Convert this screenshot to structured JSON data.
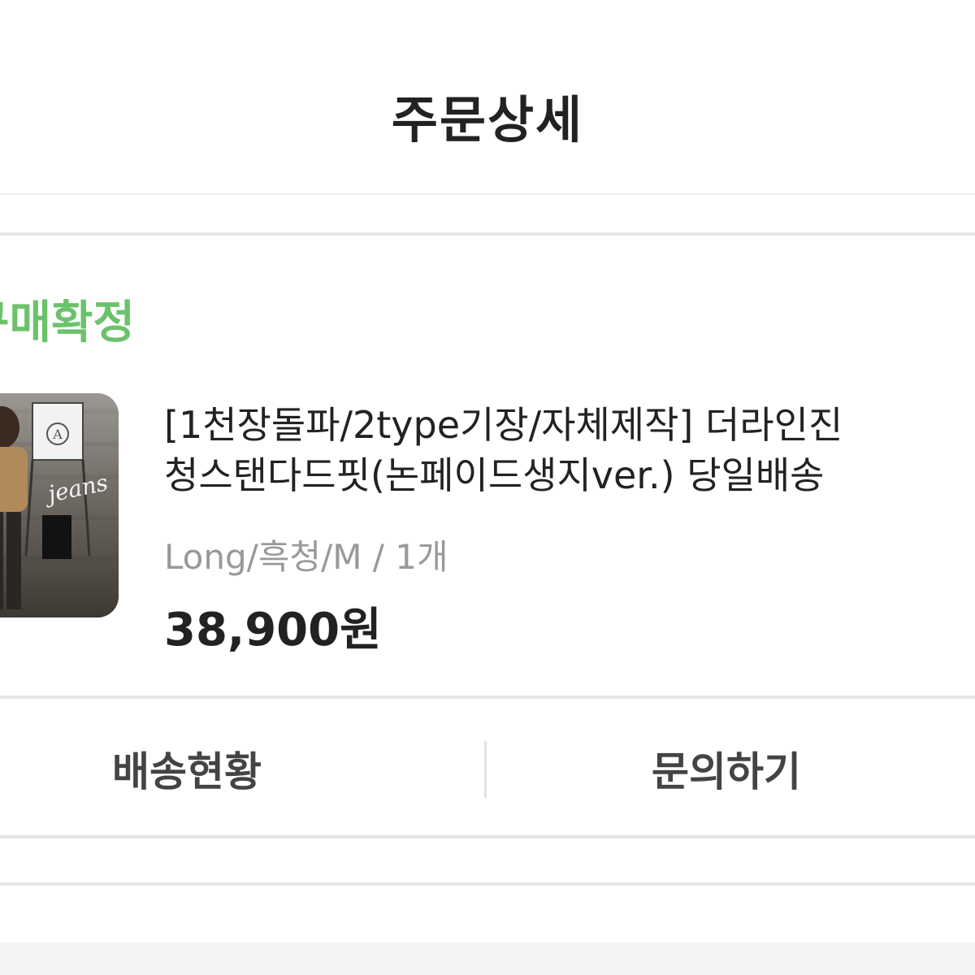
{
  "header": {
    "title": "주문상세"
  },
  "order": {
    "status": "구매확정"
  },
  "product": {
    "thumbnail_text": "jeans",
    "name_line1": "[1천장돌파/2type기장/자체제작] 더라인진",
    "name_line2": "청스탠다드핏(논페이드생지ver.) 당일배송",
    "option": "Long/흑청/M / 1개",
    "price": "38,900원"
  },
  "actions": {
    "delivery_status": "배송현황",
    "inquiry": "문의하기"
  },
  "colors": {
    "status_green": "#6cc26c",
    "divider": "#e6e6e6"
  }
}
